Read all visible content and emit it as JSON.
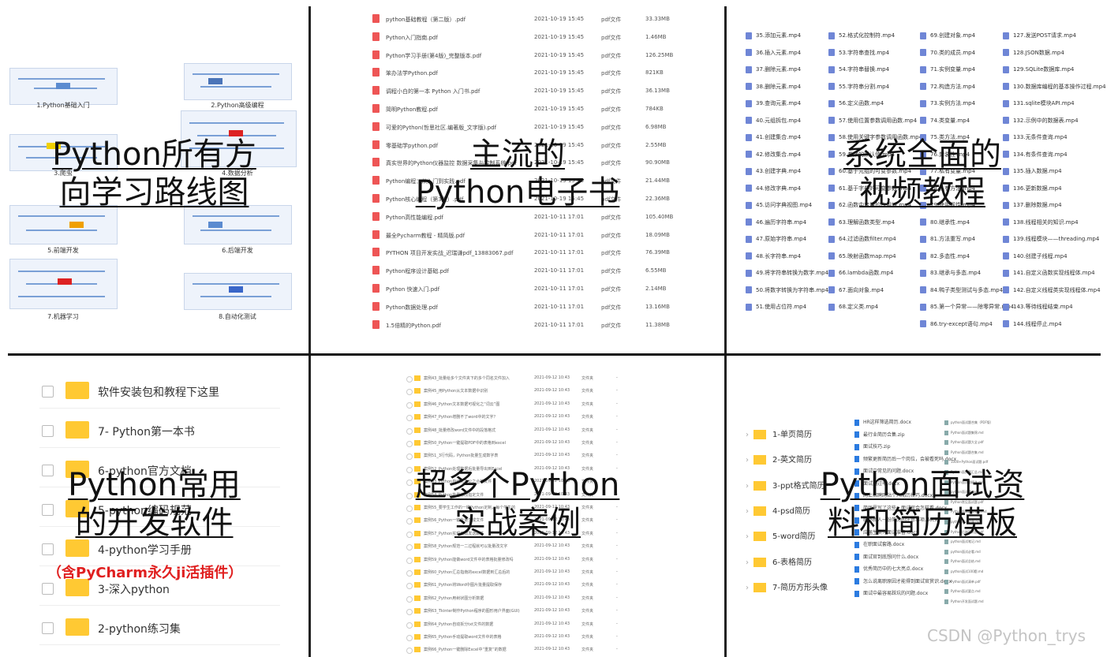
{
  "panels": {
    "roadmap": {
      "overlay": [
        "Python所有方",
        "向学习路线图"
      ],
      "items": [
        {
          "caption": "1.Python基础入门"
        },
        {
          "caption": "2.Python高级编程"
        },
        {
          "caption": "3.爬虫"
        },
        {
          "caption": "4.数据分析"
        },
        {
          "caption": "5.前端开发"
        },
        {
          "caption": "6.后端开发"
        },
        {
          "caption": "7.机器学习"
        },
        {
          "caption": "8.自动化测试"
        }
      ]
    },
    "ebooks": {
      "overlay": [
        "主流的",
        "Python电子书"
      ],
      "files": [
        {
          "name": "python基础教程（第二版）.pdf",
          "date": "2021-10-19 15:45",
          "type": "pdf文件",
          "size": "33.33MB"
        },
        {
          "name": "Python入门指南.pdf",
          "date": "2021-10-19 15:45",
          "type": "pdf文件",
          "size": "1.46MB"
        },
        {
          "name": "Python学习手册(第4版)_完整版本.pdf",
          "date": "2021-10-19 15:45",
          "type": "pdf文件",
          "size": "126.25MB"
        },
        {
          "name": "笨办法学Python.pdf",
          "date": "2021-10-19 15:45",
          "type": "pdf文件",
          "size": "821KB"
        },
        {
          "name": "调程小白的第一本 Python 入门书.pdf",
          "date": "2021-10-19 15:45",
          "type": "pdf文件",
          "size": "36.13MB"
        },
        {
          "name": "简明Python教程.pdf",
          "date": "2021-10-19 15:45",
          "type": "pdf文件",
          "size": "784KB"
        },
        {
          "name": "可爱的Python(哲思社区.编著版_文字版).pdf",
          "date": "2021-10-19 15:45",
          "type": "pdf文件",
          "size": "6.98MB"
        },
        {
          "name": "零基础学python.pdf",
          "date": "2021-10-19 15:45",
          "type": "pdf文件",
          "size": "2.55MB"
        },
        {
          "name": "真实世界的Python仪器监控  数据采集与控制系统.pdf",
          "date": "2021-10-19 15:45",
          "type": "pdf文件",
          "size": "90.90MB"
        },
        {
          "name": "Python编程：从入门到实践.pdf",
          "date": "2021-10-19 15:45",
          "type": "pdf文件",
          "size": "21.44MB"
        },
        {
          "name": "Python核心编程（第3版）.pdf",
          "date": "2021-10-19 15:45",
          "type": "pdf文件",
          "size": "22.36MB"
        },
        {
          "name": "Python高性能编程.pdf",
          "date": "2021-10-11 17:01",
          "type": "pdf文件",
          "size": "105.40MB"
        },
        {
          "name": "最全Pycharm教程 - 精简版.pdf",
          "date": "2021-10-11 17:01",
          "type": "pdf文件",
          "size": "18.09MB"
        },
        {
          "name": "PYTHON 项目开发实战_迟瑞谦pdf_13883067.pdf",
          "date": "2021-10-11 17:01",
          "type": "pdf文件",
          "size": "76.39MB"
        },
        {
          "name": "Python程序设计基础.pdf",
          "date": "2021-10-11 17:01",
          "type": "pdf文件",
          "size": "6.55MB"
        },
        {
          "name": "Python 快速入门.pdf",
          "date": "2021-10-11 17:01",
          "type": "pdf文件",
          "size": "2.14MB"
        },
        {
          "name": "Python数据处理.pdf",
          "date": "2021-10-11 17:01",
          "type": "pdf文件",
          "size": "13.16MB"
        },
        {
          "name": "1.5倍精的Python.pdf",
          "date": "2021-10-11 17:01",
          "type": "pdf文件",
          "size": "11.38MB"
        }
      ]
    },
    "videos": {
      "overlay": [
        "系统全面的",
        "视频教程"
      ],
      "columns": [
        [
          "35.添加元素.mp4",
          "36.插入元素.mp4",
          "37.删除元素.mp4",
          "38.删除元素.mp4",
          "39.查询元素.mp4",
          "40.元组拆包.mp4",
          "41.创建集合.mp4",
          "42.修改集合.mp4",
          "43.创建字典.mp4",
          "44.修改字典.mp4",
          "45.访问字典视图.mp4",
          "46.遍历字符串.mp4",
          "47.原始字符串.mp4",
          "48.长字符串.mp4",
          "49.将字符串转换为数字.mp4",
          "50.将数字转换为字符串.mp4",
          "51.使用占位符.mp4"
        ],
        [
          "52.格式化控制符.mp4",
          "53.字符串查找.mp4",
          "54.字符串替换.mp4",
          "55.字符串分割.mp4",
          "56.定义函数.mp4",
          "57.使用位置参数调用函数.mp4",
          "58.使用关键字参数调用函数.mp4",
          "59.参数的默认值.mp4",
          "60.基于元组的可变参数.mp4",
          "61.基于字典的可变参数.mp4",
          "62.函数中变量的作用域.mp4",
          "63.理解函数类型.mp4",
          "64.过滤函数filter.mp4",
          "65.映射函数map.mp4",
          "66.lambda函数.mp4",
          "67.面向对象.mp4",
          "68.定义类.mp4"
        ],
        [
          "69.创建对象.mp4",
          "70.类的成员.mp4",
          "71.实例变量.mp4",
          "72.构造方法.mp4",
          "73.实例方法.mp4",
          "74.类变量.mp4",
          "75.类方法.mp4",
          "76.封装性.mp4",
          "77.私有变量.mp4",
          "78.私有方法.mp4",
          "79.使用属性.mp4",
          "80.继承性.mp4",
          "81.方法重写.mp4",
          "82.多态性.mp4",
          "83.继承与多态.mp4",
          "84.鸭子类型测试与多态.mp4",
          "85.第一个异常——除零异常.mp4",
          "86.try-except语句.mp4"
        ],
        [
          "127.发送POST请求.mp4",
          "128.JSON数据.mp4",
          "129.SQLite数据库.mp4",
          "130.数据库编程的基本操作过程.mp4",
          "131.sqlite模块API.mp4",
          "132.示例中的数据表.mp4",
          "133.无条件查询.mp4",
          "134.有条件查询.mp4",
          "135.插入数据.mp4",
          "136.更新数据.mp4",
          "137.删除数据.mp4",
          "138.线程相关的知识.mp4",
          "139.线程模块——threading.mp4",
          "140.创建子线程.mp4",
          "141.自定义函数实现线程体.mp4",
          "142.自定义线程类实现线程体.mp4",
          "143.等待线程结束.mp4",
          "144.线程停止.mp4"
        ]
      ]
    },
    "software": {
      "overlay": [
        "Python常用",
        "的开发软件"
      ],
      "note": "（含PyCharm永久ji活插件）",
      "folders": [
        {
          "label": "软件安装包和教程下这里"
        },
        {
          "label": "7- Python第一本书"
        },
        {
          "label": "6-python官方文档"
        },
        {
          "label": "5-python编码规范"
        },
        {
          "label": "4-python学习手册"
        },
        {
          "label": "3-深入python"
        },
        {
          "label": "2-python练习集"
        }
      ]
    },
    "cases": {
      "overlay": [
        "超多个Python",
        "实战案例"
      ],
      "rows": [
        {
          "name": "案例43_批量给多个文件夹下的多个同名文件加入",
          "date": "2021-09-12 10:43",
          "type": "文件夹",
          "size": "-"
        },
        {
          "name": "案例45_用Python从文本数据中识别",
          "date": "2021-09-12 10:43",
          "type": "文件夹",
          "size": "-"
        },
        {
          "name": "案例46_Python文本数据可视化之“词云”图",
          "date": "2021-09-12 10:43",
          "type": "文件夹",
          "size": "-"
        },
        {
          "name": "案例47_Python增删不了word中的文字？",
          "date": "2021-09-12 10:43",
          "type": "文件夹",
          "size": "-"
        },
        {
          "name": "案例48_批量修改word文件中的段落格式",
          "date": "2021-09-12 10:43",
          "type": "文件夹",
          "size": "-"
        },
        {
          "name": "案例50_Python一键提取PDF中的表格到excel",
          "date": "2021-09-12 10:43",
          "type": "文件夹",
          "size": "-"
        },
        {
          "name": "案例51_3行代码，Python批量生成数字表",
          "date": "2021-09-12 10:43",
          "type": "文件夹",
          "size": "-"
        },
        {
          "name": "案例52_Python处理数据后批量导出到Excel",
          "date": "2021-09-12 10:43",
          "type": "文件夹",
          "size": "-"
        },
        {
          "name": "案例53_Python自动化办公之合并文件",
          "date": "2021-09-12 10:43",
          "type": "文件夹",
          "size": "-"
        },
        {
          "name": "案例54_Python批量修改指定文件",
          "date": "2021-09-12 10:43",
          "type": "文件夹",
          "size": "-"
        },
        {
          "name": "案例55_要学生工作的一键Python定制，每个学生的",
          "date": "2021-09-12 10:43",
          "type": "文件夹",
          "size": "-"
        },
        {
          "name": "案例56_Python一键批量生成文件",
          "date": "2021-09-12 10:43",
          "type": "文件夹",
          "size": "-"
        },
        {
          "name": "案例57_Python实现自动发送邮件",
          "date": "2021-09-12 10:43",
          "type": "文件夹",
          "size": "-"
        },
        {
          "name": "案例58_Python规范一二过程就可以批量改文字",
          "date": "2021-09-12 10:43",
          "type": "文件夹",
          "size": "-"
        },
        {
          "name": "案例59_Python能做word文件中的表格批量修改吗",
          "date": "2021-09-12 10:43",
          "type": "文件夹",
          "size": "-"
        },
        {
          "name": "案例60_Python汇总指南的excel数据到汇总后的",
          "date": "2021-09-12 10:43",
          "type": "文件夹",
          "size": "-"
        },
        {
          "name": "案例61_Python将Word中图片批量提取保存",
          "date": "2021-09-12 10:43",
          "type": "文件夹",
          "size": "-"
        },
        {
          "name": "案例62_Python用树状图分析数据",
          "date": "2021-09-12 10:43",
          "type": "文件夹",
          "size": "-"
        },
        {
          "name": "案例63_Tkinter制作Python程序的图形用户界面(GUI)",
          "date": "2021-09-12 10:43",
          "type": "文件夹",
          "size": "-"
        },
        {
          "name": "案例64_Python自动拆分txt文件的数据",
          "date": "2021-09-12 10:43",
          "type": "文件夹",
          "size": "-"
        },
        {
          "name": "案例65_Python手动提取word文件中的表格",
          "date": "2021-09-12 10:43",
          "type": "文件夹",
          "size": "-"
        },
        {
          "name": "案例66_Python一键删除Excel中“重复”的数据",
          "date": "2021-09-12 10:43",
          "type": "文件夹",
          "size": "-"
        }
      ]
    },
    "resume": {
      "overlay": [
        "Python面试资",
        "料和简历模板"
      ],
      "folders": [
        {
          "label": "1-单页简历"
        },
        {
          "label": "2-英文简历"
        },
        {
          "label": "3-ppt格式简历"
        },
        {
          "label": "4-psd简历"
        },
        {
          "label": "5-word简历"
        },
        {
          "label": "6-表格简历"
        },
        {
          "label": "7-简历方形头像"
        }
      ],
      "docs": [
        {
          "name": "HR这样筛选简历.docx"
        },
        {
          "name": "最行业简历合集.zip"
        },
        {
          "name": "面试技巧.zip"
        },
        {
          "name": "频繁更新简历后一个岗位，会被看死吗.docx"
        },
        {
          "name": "面试中常见的问题.docx"
        },
        {
          "name": "面试通过率.docx"
        },
        {
          "name": "网上招聘网站个人简历技巧.docx"
        },
        {
          "name": "简历里写了这些，面试官会怎样看.docx"
        },
        {
          "name": "职场新人一份简历的注意事项.docx"
        },
        {
          "name": "应届生实习面试准备.docx"
        },
        {
          "name": "在职面试套路.docx"
        },
        {
          "name": "面试官到底想问什么.docx"
        },
        {
          "name": "优秀简历中的七大亮点.docx"
        },
        {
          "name": "怎么说离职原因才能得到面试官赏识.docx"
        },
        {
          "name": "面试中最容易踩坑的问题.docx"
        }
      ],
      "tinyfiles": [
        {
          "name": "python面试题合集（PDF版）"
        },
        {
          "name": "Python面试题集锦.md"
        },
        {
          "name": "Python面试题大全.pdf"
        },
        {
          "name": "Python面试题合集.md"
        },
        {
          "name": "1000+Python面试题.pdf"
        },
        {
          "name": "Python面试题汇总.md"
        },
        {
          "name": "Python面试题精选.md"
        },
        {
          "name": "python面试题.md"
        },
        {
          "name": "Python常见面试题.pdf"
        },
        {
          "name": "Python面试题及答案.md"
        },
        {
          "name": "python面试宝典.md"
        },
        {
          "name": "Python后端面试题.pdf"
        },
        {
          "name": "python面试笔记.md"
        },
        {
          "name": "python面试必看.md"
        },
        {
          "name": "Python面试总结.md"
        },
        {
          "name": "python面试100题.md"
        },
        {
          "name": "Python面试清单.pdf"
        },
        {
          "name": "Python面试要点.md"
        },
        {
          "name": "Python开发面试题.md"
        }
      ]
    }
  },
  "watermark": "CSDN @Python_trys",
  "colors": {
    "accent_red": "#e02020",
    "folder": "#ffc933",
    "divider": "#111111"
  }
}
